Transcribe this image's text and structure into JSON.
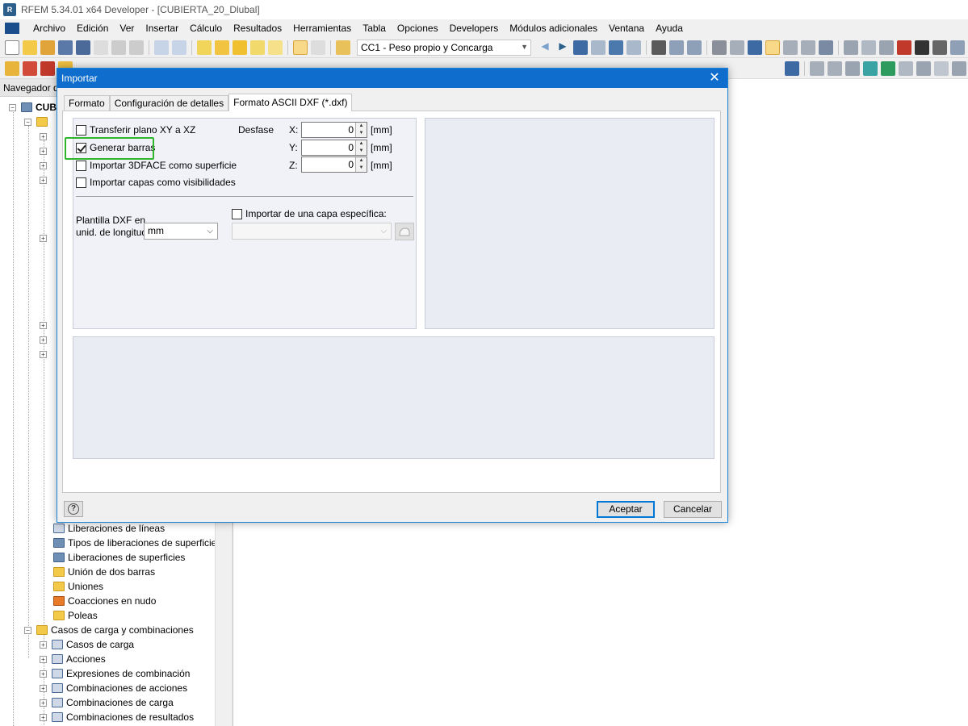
{
  "window": {
    "title": "RFEM 5.34.01 x64 Developer - [CUBIERTA_20_Dlubal]"
  },
  "menu": [
    "Archivo",
    "Edición",
    "Ver",
    "Insertar",
    "Cálculo",
    "Resultados",
    "Herramientas",
    "Tabla",
    "Opciones",
    "Developers",
    "Módulos adicionales",
    "Ventana",
    "Ayuda"
  ],
  "toolbar": {
    "load_case_combo": "CC1 - Peso propio y Concarga"
  },
  "navigator": {
    "header": "Navegador d",
    "root_label": "CUB",
    "items": [
      {
        "label": "Liberaciones de líneas"
      },
      {
        "label": "Tipos de liberaciones de superficie"
      },
      {
        "label": "Liberaciones de superficies"
      },
      {
        "label": "Unión de dos barras"
      },
      {
        "label": "Uniones"
      },
      {
        "label": "Coacciones en nudo"
      },
      {
        "label": "Poleas"
      },
      {
        "label": "Casos de carga y combinaciones"
      },
      {
        "label": "Casos de carga"
      },
      {
        "label": "Acciones"
      },
      {
        "label": "Expresiones de combinación"
      },
      {
        "label": "Combinaciones de acciones"
      },
      {
        "label": "Combinaciones de carga"
      },
      {
        "label": "Combinaciones de resultados"
      }
    ]
  },
  "dialog": {
    "title": "Importar",
    "tabs": [
      "Formato",
      "Configuración de detalles",
      "Formato ASCII DXF (*.dxf)"
    ],
    "options": {
      "transfer_plane": {
        "label": "Transferir plano XY a XZ",
        "checked": false
      },
      "generate_members": {
        "label": "Generar barras",
        "checked": true
      },
      "import_3dface": {
        "label": "Importar 3DFACE como superficie",
        "checked": false
      },
      "import_layers": {
        "label": "Importar capas como visibilidades",
        "checked": false
      }
    },
    "offset": {
      "label": "Desfase",
      "x_label": "X:",
      "x_value": "0",
      "y_label": "Y:",
      "y_value": "0",
      "z_label": "Z:",
      "z_value": "0",
      "unit": "[mm]"
    },
    "template": {
      "label_line1": "Plantilla DXF en",
      "label_line2": "unid. de longitud:",
      "value": "mm"
    },
    "layer": {
      "label": "Importar de una capa específica:",
      "checked": false,
      "value": ""
    },
    "buttons": {
      "ok": "Aceptar",
      "cancel": "Cancelar"
    }
  }
}
